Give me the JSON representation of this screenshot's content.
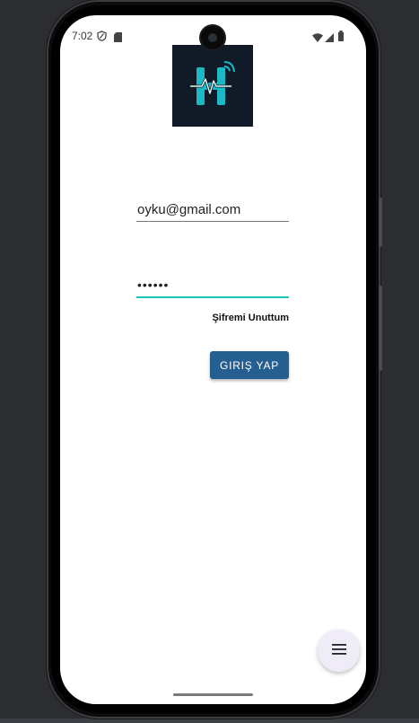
{
  "status_bar": {
    "time": "7:02"
  },
  "login": {
    "email_value": "oyku@gmail.com",
    "password_value": "••••••",
    "forgot_label": "Şifremi Unuttum",
    "login_button_label": "GIRIŞ YAP"
  },
  "colors": {
    "login_button": "#245f8f",
    "focus_underline": "#19c6b9",
    "logo_background": "#111a27",
    "logo_glyph": "#19b9c6"
  },
  "icons": [
    "shield-icon",
    "sd-card-icon",
    "wifi-icon",
    "cellular-signal-icon",
    "battery-icon",
    "app-logo",
    "menu-icon"
  ]
}
